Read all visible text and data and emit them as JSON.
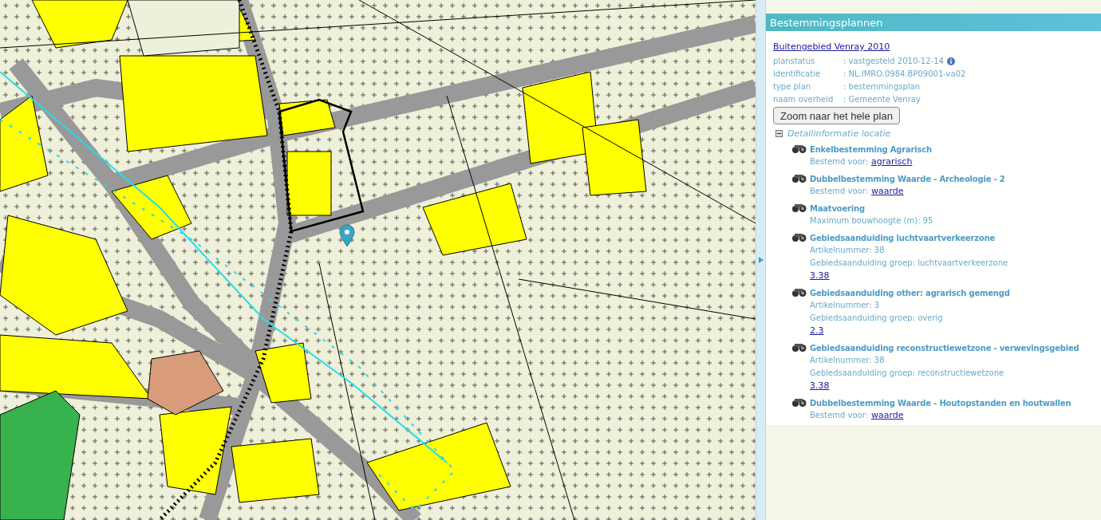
{
  "panel": {
    "title": "Bestemmingsplannen",
    "plan_link": "Buitengebied Venray 2010",
    "properties": [
      {
        "label": "planstatus",
        "value": ": vastgesteld 2010-12-14",
        "kind": "with-info"
      },
      {
        "label": "identificatie",
        "value": ": NL.IMRO.0984.BP09001-va02",
        "kind": "plain"
      },
      {
        "label": "type plan",
        "value": ": bestemmingsplan",
        "kind": "plain"
      },
      {
        "label": "naam overheid",
        "value": ": Gemeente Venray",
        "kind": "plain"
      }
    ],
    "zoom_button": "Zoom naar het hele plan",
    "detail_header": {
      "label": "Detailinformatie locatie",
      "expanded": true
    },
    "details": [
      {
        "title": "Enkelbestemming Agrarisch",
        "lines": [
          {
            "kind": "labeled-link",
            "label": "Bestemd voor:",
            "link": "agrarisch"
          }
        ]
      },
      {
        "title": "Dubbelbestemming Waarde - Archeologie - 2",
        "lines": [
          {
            "kind": "labeled-link",
            "label": "Bestemd voor:",
            "link": "waarde"
          }
        ]
      },
      {
        "title": "Maatvoering",
        "lines": [
          {
            "kind": "text",
            "label": "Maximum bouwhoogte (m): 95"
          }
        ]
      },
      {
        "title": "Gebiedsaanduiding luchtvaartverkeerzone",
        "lines": [
          {
            "kind": "text",
            "label": "Artikelnummer: 38"
          },
          {
            "kind": "text",
            "label": "Gebiedsaanduiding groep: luchtvaartverkeerzone"
          },
          {
            "kind": "link",
            "link": "3.38"
          }
        ]
      },
      {
        "title": "Gebiedsaanduiding other: agrarisch gemengd",
        "lines": [
          {
            "kind": "text",
            "label": "Artikelnummer: 3"
          },
          {
            "kind": "text",
            "label": "Gebiedsaanduiding groep: overig"
          },
          {
            "kind": "link",
            "link": "2.3"
          }
        ]
      },
      {
        "title": "Gebiedsaanduiding reconstructiewetzone - verwevingsgebied",
        "lines": [
          {
            "kind": "text",
            "label": "Artikelnummer: 38"
          },
          {
            "kind": "text",
            "label": "Gebiedsaanduiding groep: reconstructiewetzone"
          },
          {
            "kind": "link",
            "link": "3.38"
          }
        ]
      },
      {
        "title": "Dubbelbestemming Waarde - Houtopstanden en houtwallen",
        "lines": [
          {
            "kind": "labeled-link",
            "label": "Bestemd voor:",
            "link": "waarde"
          }
        ]
      }
    ]
  }
}
